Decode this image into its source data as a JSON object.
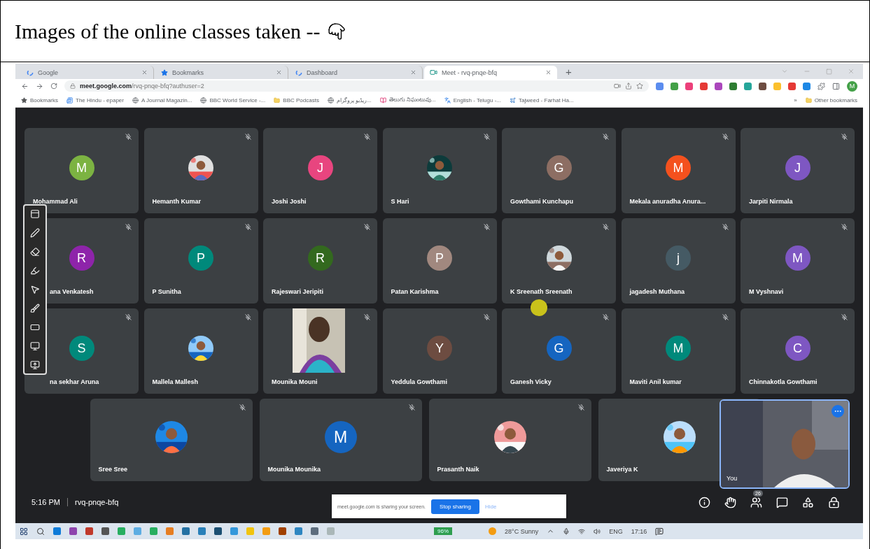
{
  "heading": {
    "text": "Images of the online classes taken --"
  },
  "browser": {
    "tabs": [
      {
        "label": "Google",
        "selected": false
      },
      {
        "label": "Bookmarks",
        "selected": false
      },
      {
        "label": "Dashboard",
        "selected": false
      },
      {
        "label": "Meet - rvq-pnqe-bfq",
        "selected": true
      }
    ],
    "new_tab": "+",
    "address": "**meet.google.com**/rvq-pnqe-bfq?authuser=2",
    "profile": "M",
    "bookmarks": [
      "Bookmarks",
      "The Hindu - epaper",
      "A Journal Magazin...",
      "BBC World Service -...",
      "BBC Podcasts",
      "ریڈیو پروگرام...",
      "తెలుగు నిఘంటువు...",
      "English - Telugu -...",
      "Tajweed - Farhat Ha..."
    ],
    "more": "»",
    "other_bookmarks": "Other bookmarks"
  },
  "meet": {
    "tile_grid": [
      [
        {
          "name": "Mohammad Ali",
          "kind": "letter",
          "letter": "M",
          "color": "#7cb342"
        },
        {
          "name": "Hemanth Kumar",
          "kind": "picture"
        },
        {
          "name": "Joshi Joshi",
          "kind": "letter",
          "letter": "J",
          "color": "#e8457f"
        },
        {
          "name": "S Hari",
          "kind": "picture"
        },
        {
          "name": "Gowthami Kunchapu",
          "kind": "letter",
          "letter": "G",
          "color": "#8d6e63"
        },
        {
          "name": "Mekala anuradha Anura...",
          "kind": "letter",
          "letter": "M",
          "color": "#f4511e"
        },
        {
          "name": "Jarpiti Nirmala",
          "kind": "letter",
          "letter": "J",
          "color": "#7e57c2"
        }
      ],
      [
        {
          "name": "ana Venkatesh",
          "kind": "letter",
          "letter": "R",
          "color": "#8e24aa"
        },
        {
          "name": "P Sunitha",
          "kind": "letter",
          "letter": "P",
          "color": "#00897b"
        },
        {
          "name": "Rajeswari Jeripiti",
          "kind": "letter",
          "letter": "R",
          "color": "#33691e"
        },
        {
          "name": "Patan Karishma",
          "kind": "letter",
          "letter": "P",
          "color": "#a1887f"
        },
        {
          "name": "K Sreenath Sreenath",
          "kind": "picture"
        },
        {
          "name": "jagadesh Muthana",
          "kind": "letter",
          "letter": "j",
          "color": "#455a64"
        },
        {
          "name": "M Vyshnavi",
          "kind": "letter",
          "letter": "M",
          "color": "#7e57c2"
        }
      ],
      [
        {
          "name": "na sekhar Aruna",
          "kind": "letter",
          "letter": "S",
          "color": "#00897b"
        },
        {
          "name": "Mallela Mallesh",
          "kind": "picture"
        },
        {
          "name": "Mounika Mouni",
          "kind": "video"
        },
        {
          "name": "Yeddula Gowthami",
          "kind": "letter",
          "letter": "Y",
          "color": "#6d4c41"
        },
        {
          "name": "Ganesh Vicky",
          "kind": "letter",
          "letter": "G",
          "color": "#1565c0"
        },
        {
          "name": "Maviti Anil kumar",
          "kind": "letter",
          "letter": "M",
          "color": "#00897b"
        },
        {
          "name": "Chinnakotla Gowthami",
          "kind": "letter",
          "letter": "C",
          "color": "#7e57c2"
        }
      ]
    ],
    "bottom_tiles": [
      {
        "name": "Sree Sree",
        "kind": "picture"
      },
      {
        "name": "Mounika Mounika",
        "kind": "letter",
        "letter": "M",
        "color": "#1565c0"
      },
      {
        "name": "Prasanth Naik",
        "kind": "picture"
      },
      {
        "name": "Javeriya K",
        "kind": "picture"
      }
    ],
    "self_view": {
      "label": "You"
    },
    "time": "5:16 PM",
    "code": "rvq-pnqe-bfq",
    "share_notice": {
      "text": "meet.google.com is sharing your screen.",
      "stop": "Stop sharing",
      "hide": "Hide"
    },
    "participant_count": "26"
  },
  "taskbar": {
    "battery": "96%",
    "weather": "28°C Sunny",
    "language": "ENG",
    "time": "17:16"
  }
}
